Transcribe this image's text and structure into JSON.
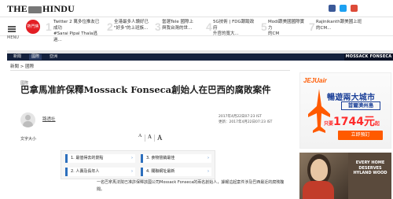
{
  "header": {
    "logo": "THE HINDU"
  },
  "trending": {
    "label": "熱門焦點",
    "items": [
      {
        "num": "1",
        "text": "Twitter 2 萬多位推友已成功\n#Sarai Pipal Thala逃過..."
      },
      {
        "num": "2",
        "text": "全港最多人讚好已\n\"好多\"的上班族..."
      },
      {
        "num": "3",
        "text": "當選Tele 國際上\n與我台灣的世..."
      },
      {
        "num": "4",
        "text": "5G技術 | FDG跟蹤政府\n升官的寬大..."
      },
      {
        "num": "5",
        "text": "Modi跟美國國際實力\n的CM"
      },
      {
        "num": "7",
        "text": "Rajinikanth跟美國上班\n的CM..."
      }
    ]
  },
  "menu_label": "MENU",
  "nav": {
    "items": [
      "新聞",
      "國際",
      "亞洲"
    ],
    "sponsor": "MOSSACK FONSECA"
  },
  "breadcrumb": "新聞 > 國際",
  "article": {
    "section": "國際",
    "headline": "巴拿馬准許保釋Mossack Fonseca創始人在巴西的腐敗案件",
    "byline": "路透社",
    "date_published": "2017年4月22日07:23 IST",
    "date_updated": "更新：2017年4月22日07:23 IST",
    "text_size_label": "文字大小",
    "body": "一名巴拿馬法院已准許保釋該國公司Mossack Fonseca的兩名創始人，據報這起案件涉及巴西最近的腐敗醜聞。"
  },
  "related": {
    "items": [
      {
        "num": "1.",
        "text": "最值得去的景點"
      },
      {
        "num": "2.",
        "text": "人壽及長年人"
      },
      {
        "num": "3.",
        "text": "食物營銷最佳"
      },
      {
        "num": "4.",
        "text": "關聯網址最新"
      }
    ]
  },
  "ads": {
    "jeju": {
      "brand": "JEJUair",
      "headline": "暢遊兩大城市",
      "subhead": "首爾濟州島",
      "price_prefix": "只要",
      "price": "1744元",
      "price_suffix": "起",
      "button": "立即預訂"
    },
    "home": {
      "text": "EVERY HOME DESERVES HYLAND WOOD"
    }
  },
  "colors": {
    "nav_bg": "#14213d",
    "accent_red": "#e31e24",
    "ad_orange": "#ff5a00"
  }
}
